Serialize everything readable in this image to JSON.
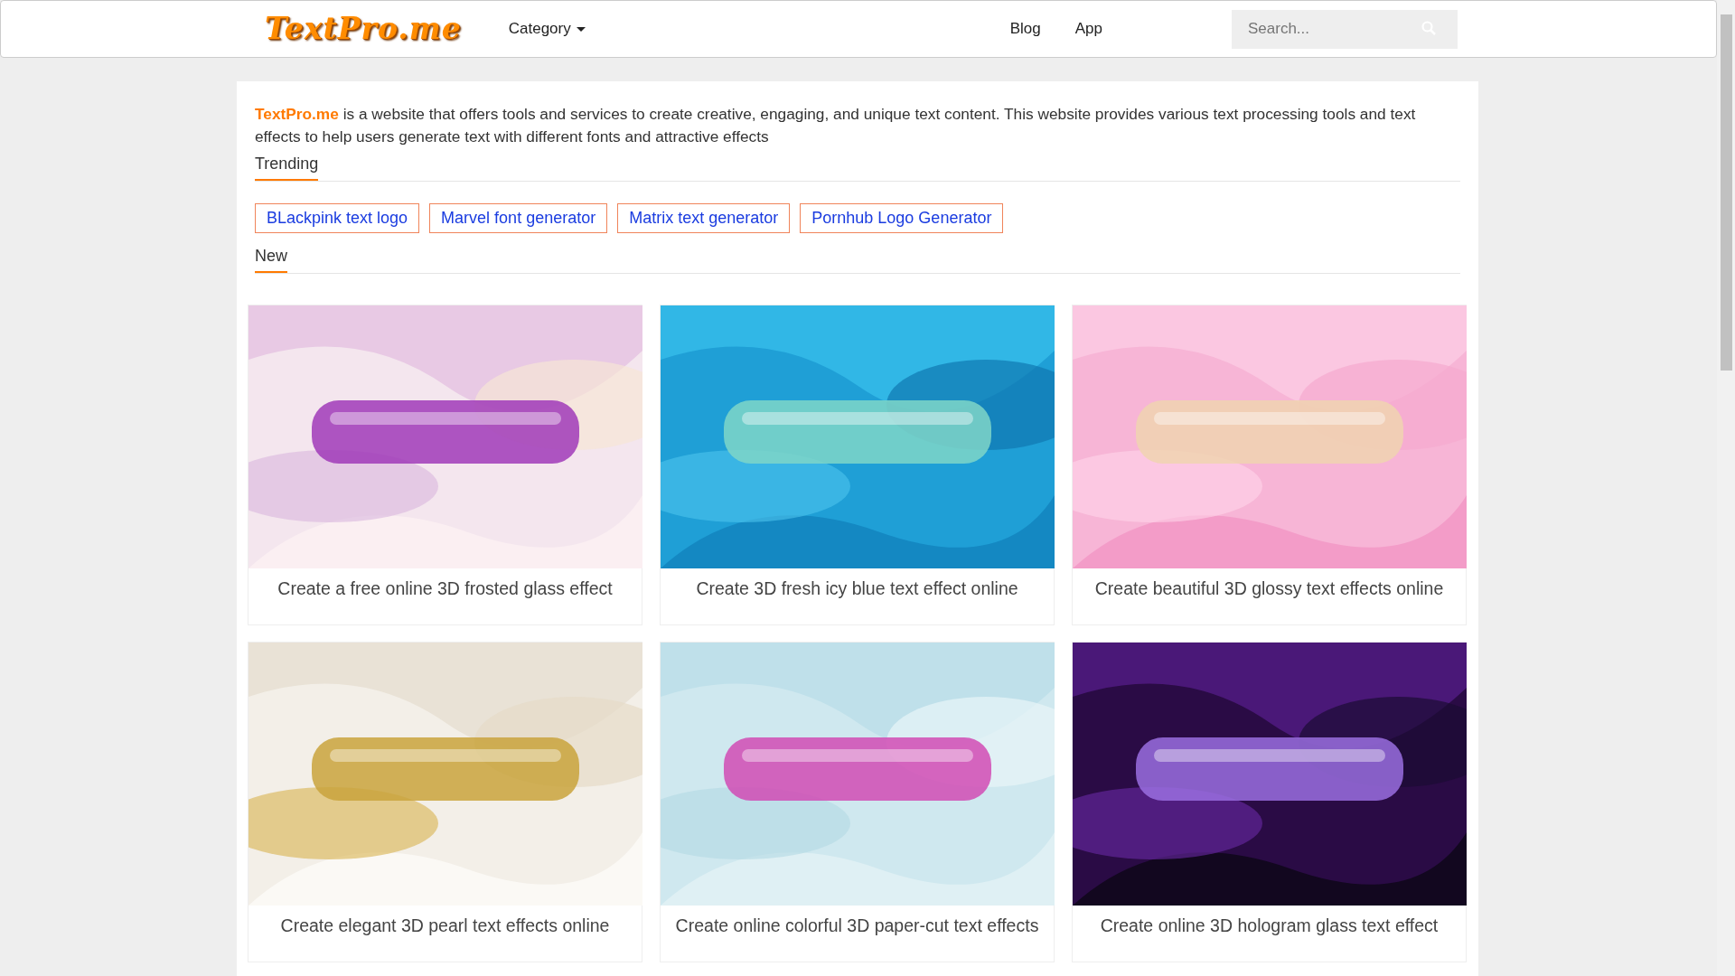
{
  "navbar": {
    "logo": "TextPro.me",
    "menu": [
      {
        "label": "Category",
        "dropdown": true
      },
      {
        "label": "Blog",
        "dropdown": false
      },
      {
        "label": "App",
        "dropdown": false
      }
    ],
    "search": {
      "placeholder": "Search..."
    }
  },
  "intro": "**TextPro.me** is a website that offers tools and services to create creative, engaging, and unique text content. This website provides various text processing tools and text effects to help users generate text with different fonts and attractive effects",
  "trending": {
    "heading": "Trending",
    "tags": [
      "BLackpink text logo",
      "Marvel font generator",
      "Matrix text generator",
      "Pornhub Logo Generator"
    ]
  },
  "new": {
    "heading": "New",
    "cards": [
      {
        "title": "Create a free online 3D frosted glass effect"
      },
      {
        "title": "Create 3D fresh icy blue text effect online"
      },
      {
        "title": "Create beautiful 3D glossy text effects online"
      },
      {
        "title": "Create elegant 3D pearl text effects online"
      },
      {
        "title": "Create online colorful 3D paper-cut text effects"
      },
      {
        "title": "Create online 3D hologram glass text effect"
      }
    ]
  }
}
